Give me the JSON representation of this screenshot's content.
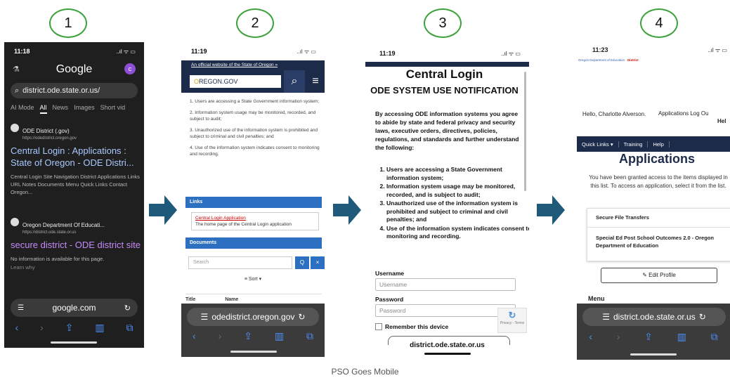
{
  "steps": [
    "1",
    "2",
    "3",
    "4"
  ],
  "caption": "PSO Goes Mobile",
  "colors": {
    "step_circle": "#3ca23c",
    "arrow": "#1f5a7a",
    "oregon_navy": "#1c2b4a",
    "link_blue": "#2d6fc0"
  },
  "phone1": {
    "time": "11:18",
    "status_icons": "..ıl ᯤ ▭",
    "logo": "Google",
    "avatar": "c",
    "search_value": "district.ode.state.or.us/",
    "tabs": [
      "AI Mode",
      "All",
      "News",
      "Images",
      "Short vid"
    ],
    "result1": {
      "site": "ODE District (.gov)",
      "url": "https://odedistrict.oregon.gov",
      "title": "Central Login : Applications : State of Oregon - ODE Distri...",
      "desc": "Central Login Site Navigation District Applications Links URL Notes Documents Menu Quick Links Contact Oregon..."
    },
    "result2": {
      "site": "Oregon Department Of Educati...",
      "url": "https://district.ode.state.or.us",
      "title": "secure district - ODE district site",
      "desc": "No information is available for this page.",
      "learn": "Learn why"
    },
    "address": "google.com"
  },
  "phone2": {
    "time": "11:19",
    "gov_banner": "An official website of the State of Oregon »",
    "logo": "OREGON.GOV",
    "notice_items": [
      "1. Users are accessing a State Government information system;",
      "2. Information system usage may be monitored, recorded, and subject to audit;",
      "3. Unauthorized use of the information system is prohibited and subject to criminal and civil penalties; and",
      "4. Use of the information system indicates consent to monitoring and recording."
    ],
    "links_header": "Links",
    "link_title": "Central Login Application",
    "link_desc": "The home page of the Central Login application",
    "documents_header": "Documents",
    "search_placeholder": "Search",
    "search_btn": "Q",
    "clear_btn": "×",
    "sort_label": "Sort ▾",
    "col_title": "Title",
    "col_name": "Name",
    "address": "odedistrict.oregon.gov"
  },
  "phone3": {
    "time": "11:19",
    "heading": "Central Login",
    "subheading": "ODE SYSTEM USE NOTIFICATION",
    "intro": "By accessing ODE information systems you agree to abide by state and federal privacy and security laws, executive orders, directives, policies, regulations, and standards and further understand the following:",
    "items": [
      "Users are accessing a State Government information system;",
      "Information system usage may be monitored, recorded, and is subject to audit;",
      "Unauthorized use of the information system is prohibited and subject to criminal and civil penalties; and",
      "Use of the information system indicates consent to monitoring and recording."
    ],
    "username_label": "Username",
    "username_placeholder": "Username",
    "password_label": "Password",
    "password_placeholder": "Password",
    "remember": "Remember this device",
    "captcha_text": "Privacy - Terms",
    "address": "district.ode.state.or.us"
  },
  "phone4": {
    "time": "11:23",
    "ode_banner": "Oregon Department of Education -",
    "ode_banner_red": "District",
    "hello": "Hello, Charlotte Alverson.",
    "nav_links": "Applications   Log Ou",
    "help": "Hel",
    "quick_links": [
      "Quick Links ▾",
      "Training",
      "Help"
    ],
    "heading": "Applications",
    "desc": "You have been granted access to the items displayed in this list. To access an application, select it from the list.",
    "app1": "Secure File Transfers",
    "app2": "Special Ed Post School Outcomes 2.0 - Oregon Department of Education",
    "edit_profile": "✎ Edit Profile",
    "menu": "Menu",
    "address": "district.ode.state.or.us"
  }
}
